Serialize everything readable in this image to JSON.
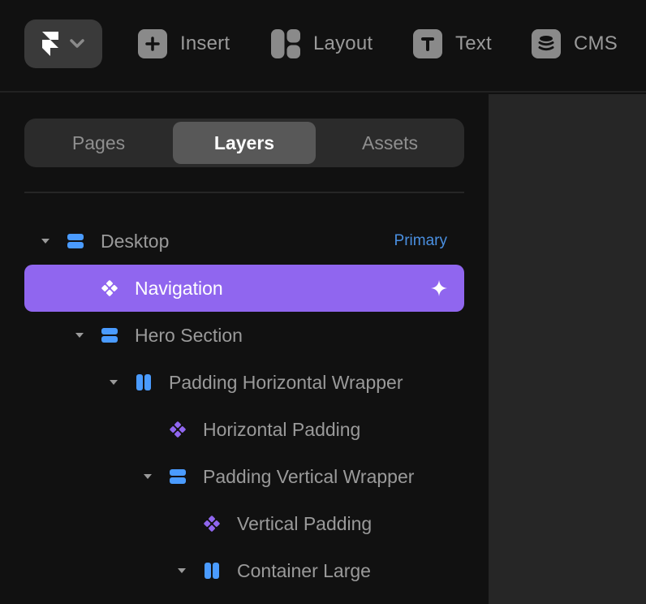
{
  "toolbar": {
    "logo_icon": "framer-logo-icon",
    "logo_menu_icon": "chevron-down-icon",
    "tools": [
      {
        "label": "Insert",
        "icon": "plus-icon"
      },
      {
        "label": "Layout",
        "icon": "layout-icon"
      },
      {
        "label": "Text",
        "icon": "text-t-icon"
      },
      {
        "label": "CMS",
        "icon": "database-icon"
      }
    ]
  },
  "panel": {
    "tabs": [
      {
        "label": "Pages",
        "active": false
      },
      {
        "label": "Layers",
        "active": true
      },
      {
        "label": "Assets",
        "active": false
      }
    ],
    "layers": [
      {
        "name": "Desktop",
        "depth": 0,
        "expanded": true,
        "icon": "stack-vertical-icon",
        "badge": "Primary",
        "selected": false
      },
      {
        "name": "Navigation",
        "depth": 1,
        "expanded": null,
        "icon": "component-icon",
        "selected": true,
        "trailing_icon": "sparkle-icon"
      },
      {
        "name": "Hero Section",
        "depth": 1,
        "expanded": true,
        "icon": "stack-vertical-icon",
        "selected": false
      },
      {
        "name": "Padding Horizontal Wrapper",
        "depth": 2,
        "expanded": true,
        "icon": "stack-horizontal-icon",
        "selected": false
      },
      {
        "name": "Horizontal Padding",
        "depth": 3,
        "expanded": null,
        "icon": "component-icon",
        "selected": false
      },
      {
        "name": "Padding Vertical Wrapper",
        "depth": 3,
        "expanded": true,
        "icon": "stack-vertical-icon",
        "selected": false
      },
      {
        "name": "Vertical Padding",
        "depth": 4,
        "expanded": null,
        "icon": "component-icon",
        "selected": false
      },
      {
        "name": "Container Large",
        "depth": 4,
        "expanded": true,
        "icon": "stack-horizontal-icon",
        "selected": false
      }
    ]
  },
  "colors": {
    "accent": "#9066ef",
    "stack_blue": "#4a9bff",
    "component_purple": "#9066ef",
    "badge_blue": "#4a8fe0"
  }
}
